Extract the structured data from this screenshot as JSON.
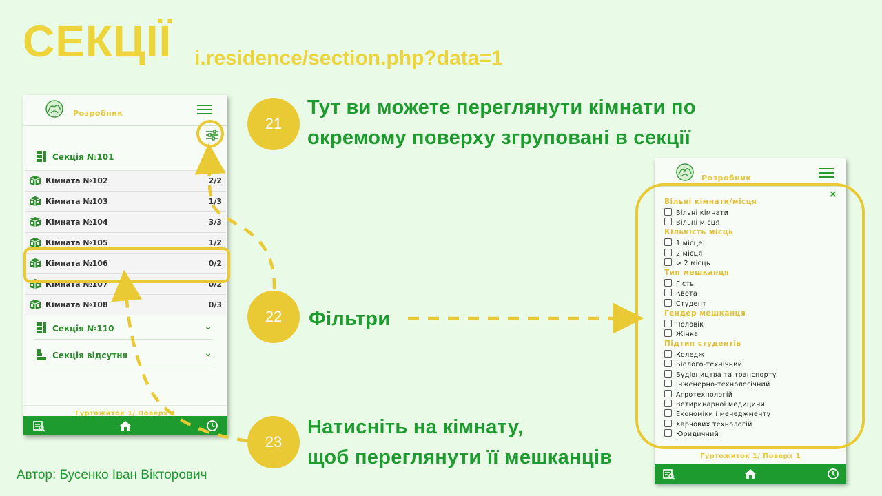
{
  "slide": {
    "title": "СЕКЦІЇ",
    "url": "i.residence/section.php?data=1",
    "author": "Автор: Бусенко Іван Вікторович"
  },
  "callouts": [
    {
      "num": "21",
      "text_line1": "Тут ви можете переглянути кімнати по",
      "text_line2": "окремому поверху згруповані в секції"
    },
    {
      "num": "22",
      "text_line1": "Фільтри"
    },
    {
      "num": "23",
      "text_line1": "Натисніть на кімнату,",
      "text_line2": "щоб переглянути її мешканців"
    }
  ],
  "phone_left": {
    "app_title": "Розробник",
    "sections": [
      {
        "label": "Секція №101",
        "expanded": true
      },
      {
        "label": "Секція №110",
        "expanded": false
      },
      {
        "label": "Секція відсутня",
        "expanded": false
      }
    ],
    "rooms": [
      {
        "name": "Кімната №102",
        "count": "2/2"
      },
      {
        "name": "Кімната №103",
        "count": "1/3"
      },
      {
        "name": "Кімната №104",
        "count": "3/3"
      },
      {
        "name": "Кімната №105",
        "count": "1/2"
      },
      {
        "name": "Кімната №106",
        "count": "0/2"
      },
      {
        "name": "Кімната №107",
        "count": "0/2"
      },
      {
        "name": "Кімната №108",
        "count": "0/3"
      }
    ],
    "footer": "Гуртожиток 1/ Поверх 1"
  },
  "phone_right": {
    "app_title": "Розробник",
    "close_label": "×",
    "filters": [
      {
        "heading": "Вільні кімнати/місця",
        "options": [
          "Вільні кімнати",
          "Вільні місця"
        ]
      },
      {
        "heading": "Кількість місць",
        "options": [
          "1 місце",
          "2 місця",
          "> 2 місць"
        ]
      },
      {
        "heading": "Тип мешканця",
        "options": [
          "Гість",
          "Квота",
          "Студент"
        ]
      },
      {
        "heading": "Гендер мешканця",
        "options": [
          "Чоловік",
          "Жінка"
        ]
      },
      {
        "heading": "Підтип студентів",
        "options": [
          "Коледж",
          "Біолого-технічний",
          "Будівництва та транспорту",
          "Інженерно-технологічний",
          "Агротехнологій",
          "Ветиринарної медицини",
          "Економіки і менеджменту",
          "Харчових технологій",
          "Юридичний"
        ]
      }
    ],
    "footer": "Гуртожиток 1/ Поверх 1"
  },
  "colors": {
    "accent_yellow": "#e9c934",
    "accent_green": "#1e9b2e",
    "background": "#e9fbe6"
  },
  "icons": [
    "logo-icon",
    "menu-icon",
    "filter-icon",
    "section-icon",
    "room-icon",
    "chevron-up-icon",
    "chevron-down-icon",
    "search-list-icon",
    "home-icon",
    "history-icon",
    "close-icon"
  ]
}
